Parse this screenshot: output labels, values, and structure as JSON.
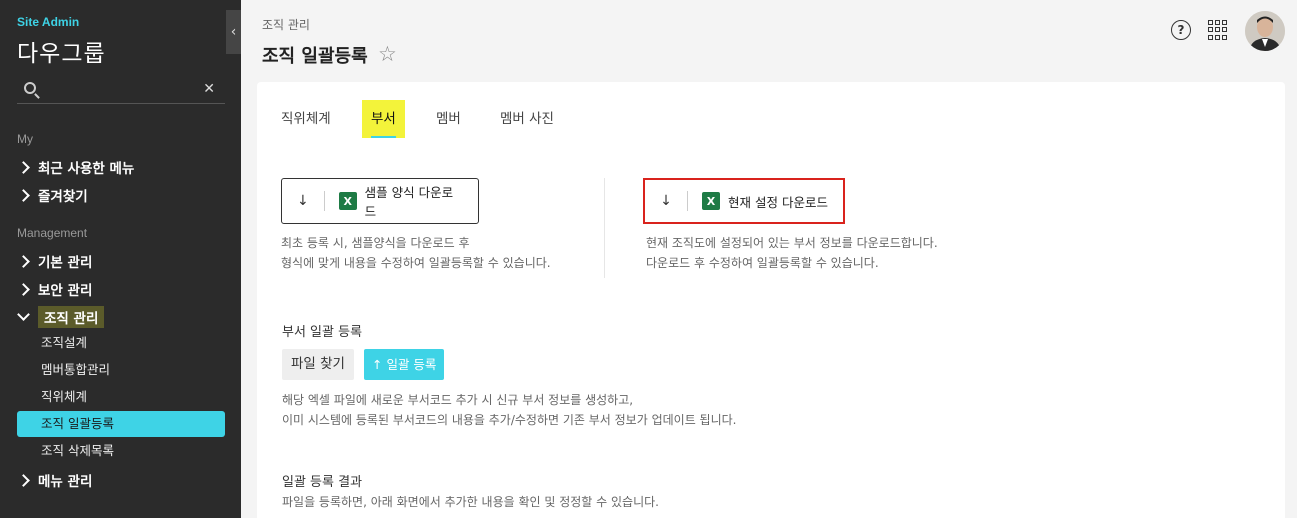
{
  "sidebar": {
    "site_label": "Site Admin",
    "site_name": "다우그룹",
    "search": {
      "value": "",
      "placeholder": ""
    },
    "sections": {
      "my": "My",
      "management": "Management"
    },
    "my_items": [
      "최근 사용한 메뉴",
      "즐겨찾기"
    ],
    "management_groups": {
      "basic": "기본 관리",
      "security": "보안 관리",
      "org": "조직 관리",
      "menu": "메뉴 관리"
    },
    "org_sub_items": [
      "조직설계",
      "멤버통합관리",
      "직위체계",
      "조직 일괄등록",
      "조직 삭제목록"
    ]
  },
  "header": {
    "breadcrumb": "조직 관리",
    "title": "조직 일괄등록"
  },
  "tabs": [
    "직위체계",
    "부서",
    "멤버",
    "멤버 사진"
  ],
  "active_tab": "부서",
  "download": {
    "sample_label": "샘플 양식 다운로드",
    "sample_desc_1": "최초 등록 시, 샘플양식을 다운로드 후",
    "sample_desc_2": "형식에 맞게 내용을 수정하여 일괄등록할 수 있습니다.",
    "current_label": "현재 설정 다운로드",
    "current_desc_1": "현재 조직도에 설정되어 있는 부서 정보를 다운로드합니다.",
    "current_desc_2": "다운로드 후 수정하여 일괄등록할 수 있습니다."
  },
  "bulk": {
    "title": "부서 일괄 등록",
    "find_file": "파일 찾기",
    "upload": "일괄 등록",
    "desc_1": "해당 엑셀 파일에 새로운 부서코드 추가 시 신규 부서 정보를 생성하고,",
    "desc_2": "이미 시스템에 등록된 부서코드의 내용을 추가/수정하면 기존 부서 정보가 업데이트 됩니다."
  },
  "result": {
    "title": "일괄 등록 결과",
    "desc": "파일을 등록하면, 아래 화면에서 추가한 내용을 확인 및 정정할 수 있습니다."
  },
  "colors": {
    "accent": "#3ed3e6",
    "highlight_border": "#d9231d",
    "tab_highlight": "#f3f33a",
    "sidebar_bg": "#2b2b2b"
  }
}
